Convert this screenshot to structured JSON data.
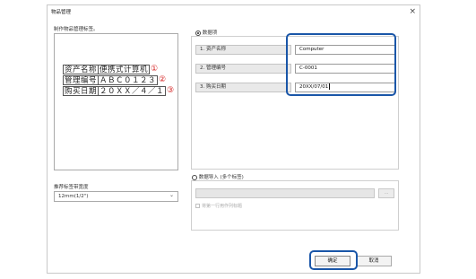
{
  "dialog": {
    "title": "物品管理",
    "close_glyph": "×"
  },
  "left": {
    "preview_label": "制作物品管理标签。",
    "label_rows": [
      {
        "key": "资产名称",
        "value": "便携式计算机",
        "marker": "①"
      },
      {
        "key": "管理编号",
        "value": "ＡＢＣ０１２３",
        "marker": "②"
      },
      {
        "key": "购买日期",
        "value": "２０ＸＸ／４／１",
        "marker": "③"
      }
    ],
    "width_label": "推荐标签带宽度",
    "width_value": "12mm(1/2\")",
    "width_caret": "⌄"
  },
  "data_items": {
    "option_label": "数据项",
    "selected": true,
    "fields": [
      {
        "label": "1. 资产名称",
        "value": "Computer"
      },
      {
        "label": "2. 管理编号",
        "value": "C-0001"
      },
      {
        "label": "3. 购买日期",
        "value": "20XX/07/01"
      }
    ]
  },
  "data_import": {
    "option_label": "数据导入 (多个标签)",
    "selected": false,
    "browse_label": "...",
    "checkbox_label": "将第一行用作列标题"
  },
  "buttons": {
    "ok": "确定",
    "cancel": "取消"
  },
  "colors": {
    "highlight": "#1a56a8",
    "marker": "#d42020"
  }
}
